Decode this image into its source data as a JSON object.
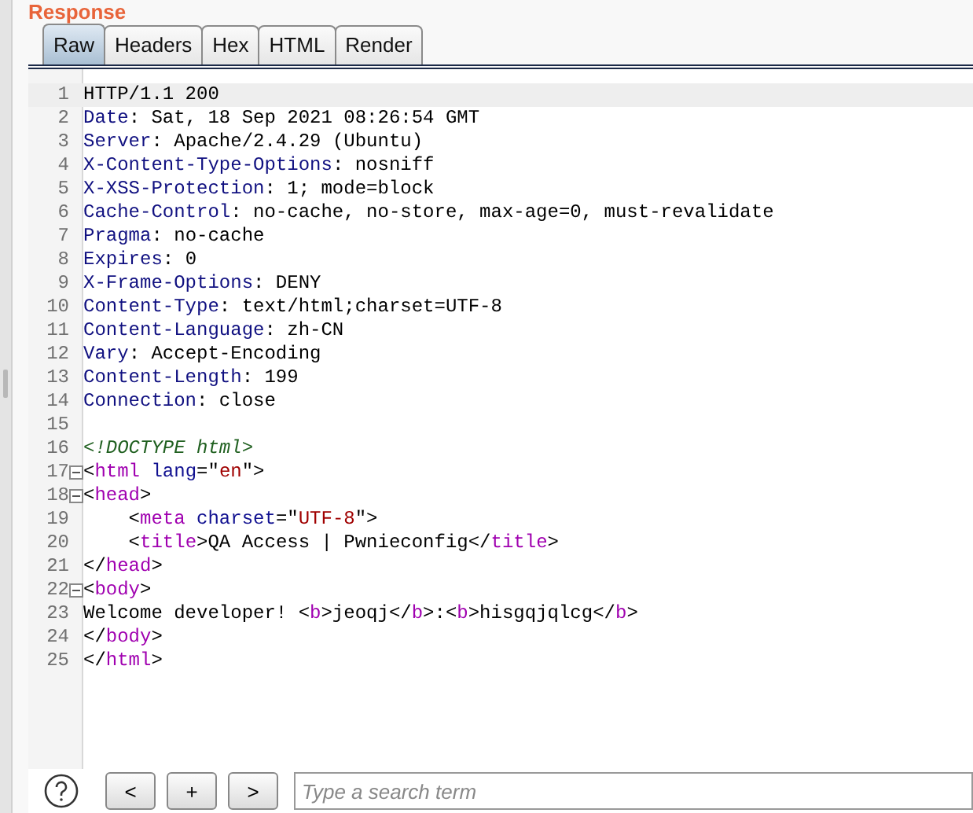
{
  "panel_title": "Response",
  "tabs": [
    {
      "label": "Raw",
      "selected": true
    },
    {
      "label": "Headers",
      "selected": false
    },
    {
      "label": "Hex",
      "selected": false
    },
    {
      "label": "HTML",
      "selected": false
    },
    {
      "label": "Render",
      "selected": false
    }
  ],
  "lines": [
    {
      "number": "1",
      "selected": true,
      "foldable": false,
      "tokens": [
        {
          "kind": "plain",
          "text": "HTTP/1.1 200"
        }
      ]
    },
    {
      "number": "2",
      "selected": false,
      "foldable": false,
      "tokens": [
        {
          "kind": "key",
          "text": "Date"
        },
        {
          "kind": "plain",
          "text": ": Sat, 18 Sep 2021 08:26:54 GMT"
        }
      ]
    },
    {
      "number": "3",
      "selected": false,
      "foldable": false,
      "tokens": [
        {
          "kind": "key",
          "text": "Server"
        },
        {
          "kind": "plain",
          "text": ": Apache/2.4.29 (Ubuntu)"
        }
      ]
    },
    {
      "number": "4",
      "selected": false,
      "foldable": false,
      "tokens": [
        {
          "kind": "key",
          "text": "X-Content-Type-Options"
        },
        {
          "kind": "plain",
          "text": ": nosniff"
        }
      ]
    },
    {
      "number": "5",
      "selected": false,
      "foldable": false,
      "tokens": [
        {
          "kind": "key",
          "text": "X-XSS-Protection"
        },
        {
          "kind": "plain",
          "text": ": 1; mode=block"
        }
      ]
    },
    {
      "number": "6",
      "selected": false,
      "foldable": false,
      "tokens": [
        {
          "kind": "key",
          "text": "Cache-Control"
        },
        {
          "kind": "plain",
          "text": ": no-cache, no-store, max-age=0, must-revalidate"
        }
      ]
    },
    {
      "number": "7",
      "selected": false,
      "foldable": false,
      "tokens": [
        {
          "kind": "key",
          "text": "Pragma"
        },
        {
          "kind": "plain",
          "text": ": no-cache"
        }
      ]
    },
    {
      "number": "8",
      "selected": false,
      "foldable": false,
      "tokens": [
        {
          "kind": "key",
          "text": "Expires"
        },
        {
          "kind": "plain",
          "text": ": 0"
        }
      ]
    },
    {
      "number": "9",
      "selected": false,
      "foldable": false,
      "tokens": [
        {
          "kind": "key",
          "text": "X-Frame-Options"
        },
        {
          "kind": "plain",
          "text": ": DENY"
        }
      ]
    },
    {
      "number": "10",
      "selected": false,
      "foldable": false,
      "tokens": [
        {
          "kind": "key",
          "text": "Content-Type"
        },
        {
          "kind": "plain",
          "text": ": text/html;charset=UTF-8"
        }
      ]
    },
    {
      "number": "11",
      "selected": false,
      "foldable": false,
      "tokens": [
        {
          "kind": "key",
          "text": "Content-Language"
        },
        {
          "kind": "plain",
          "text": ": zh-CN"
        }
      ]
    },
    {
      "number": "12",
      "selected": false,
      "foldable": false,
      "tokens": [
        {
          "kind": "key",
          "text": "Vary"
        },
        {
          "kind": "plain",
          "text": ": Accept-Encoding"
        }
      ]
    },
    {
      "number": "13",
      "selected": false,
      "foldable": false,
      "tokens": [
        {
          "kind": "key",
          "text": "Content-Length"
        },
        {
          "kind": "plain",
          "text": ": 199"
        }
      ]
    },
    {
      "number": "14",
      "selected": false,
      "foldable": false,
      "tokens": [
        {
          "kind": "key",
          "text": "Connection"
        },
        {
          "kind": "plain",
          "text": ": close"
        }
      ]
    },
    {
      "number": "15",
      "selected": false,
      "foldable": false
    },
    {
      "number": "16",
      "selected": false,
      "foldable": false,
      "tokens": [
        {
          "kind": "doctype",
          "text": "<!DOCTYPE html>"
        }
      ]
    },
    {
      "number": "17",
      "selected": false,
      "foldable": true,
      "tokens": [
        {
          "kind": "plain",
          "text": "<"
        },
        {
          "kind": "tag",
          "text": "html"
        },
        {
          "kind": "attr",
          "text": " lang"
        },
        {
          "kind": "plain",
          "text": "=\""
        },
        {
          "kind": "string",
          "text": "en"
        },
        {
          "kind": "plain",
          "text": "\">"
        }
      ]
    },
    {
      "number": "18",
      "selected": false,
      "foldable": true,
      "tokens": [
        {
          "kind": "plain",
          "text": "<"
        },
        {
          "kind": "tag",
          "text": "head"
        },
        {
          "kind": "plain",
          "text": ">"
        }
      ]
    },
    {
      "number": "19",
      "selected": false,
      "foldable": false,
      "tokens": [
        {
          "kind": "plain",
          "text": "    <"
        },
        {
          "kind": "tag",
          "text": "meta"
        },
        {
          "kind": "attr",
          "text": " charset"
        },
        {
          "kind": "plain",
          "text": "=\""
        },
        {
          "kind": "string",
          "text": "UTF-8"
        },
        {
          "kind": "plain",
          "text": "\">"
        }
      ]
    },
    {
      "number": "20",
      "selected": false,
      "foldable": false,
      "tokens": [
        {
          "kind": "plain",
          "text": "    <"
        },
        {
          "kind": "tag",
          "text": "title"
        },
        {
          "kind": "plain",
          "text": ">QA Access | Pwnieconfig</"
        },
        {
          "kind": "tag",
          "text": "title"
        },
        {
          "kind": "plain",
          "text": ">"
        }
      ]
    },
    {
      "number": "21",
      "selected": false,
      "foldable": false,
      "tokens": [
        {
          "kind": "plain",
          "text": "</"
        },
        {
          "kind": "tag",
          "text": "head"
        },
        {
          "kind": "plain",
          "text": ">"
        }
      ]
    },
    {
      "number": "22",
      "selected": false,
      "foldable": true,
      "tokens": [
        {
          "kind": "plain",
          "text": "<"
        },
        {
          "kind": "tag",
          "text": "body"
        },
        {
          "kind": "plain",
          "text": ">"
        }
      ]
    },
    {
      "number": "23",
      "selected": false,
      "foldable": false,
      "tokens": [
        {
          "kind": "plain",
          "text": "Welcome developer! <"
        },
        {
          "kind": "tag",
          "text": "b"
        },
        {
          "kind": "plain",
          "text": ">jeoqj</"
        },
        {
          "kind": "tag",
          "text": "b"
        },
        {
          "kind": "plain",
          "text": ">:<"
        },
        {
          "kind": "tag",
          "text": "b"
        },
        {
          "kind": "plain",
          "text": ">hisgqjqlcg</"
        },
        {
          "kind": "tag",
          "text": "b"
        },
        {
          "kind": "plain",
          "text": ">"
        }
      ]
    },
    {
      "number": "24",
      "selected": false,
      "foldable": false,
      "tokens": [
        {
          "kind": "plain",
          "text": "</"
        },
        {
          "kind": "tag",
          "text": "body"
        },
        {
          "kind": "plain",
          "text": ">"
        }
      ]
    },
    {
      "number": "25",
      "selected": false,
      "foldable": false,
      "tokens": [
        {
          "kind": "plain",
          "text": "</"
        },
        {
          "kind": "tag",
          "text": "html"
        },
        {
          "kind": "plain",
          "text": ">"
        }
      ]
    }
  ],
  "nav_buttons": [
    "<",
    "+",
    ">"
  ],
  "search": {
    "placeholder": "Type a search term"
  }
}
